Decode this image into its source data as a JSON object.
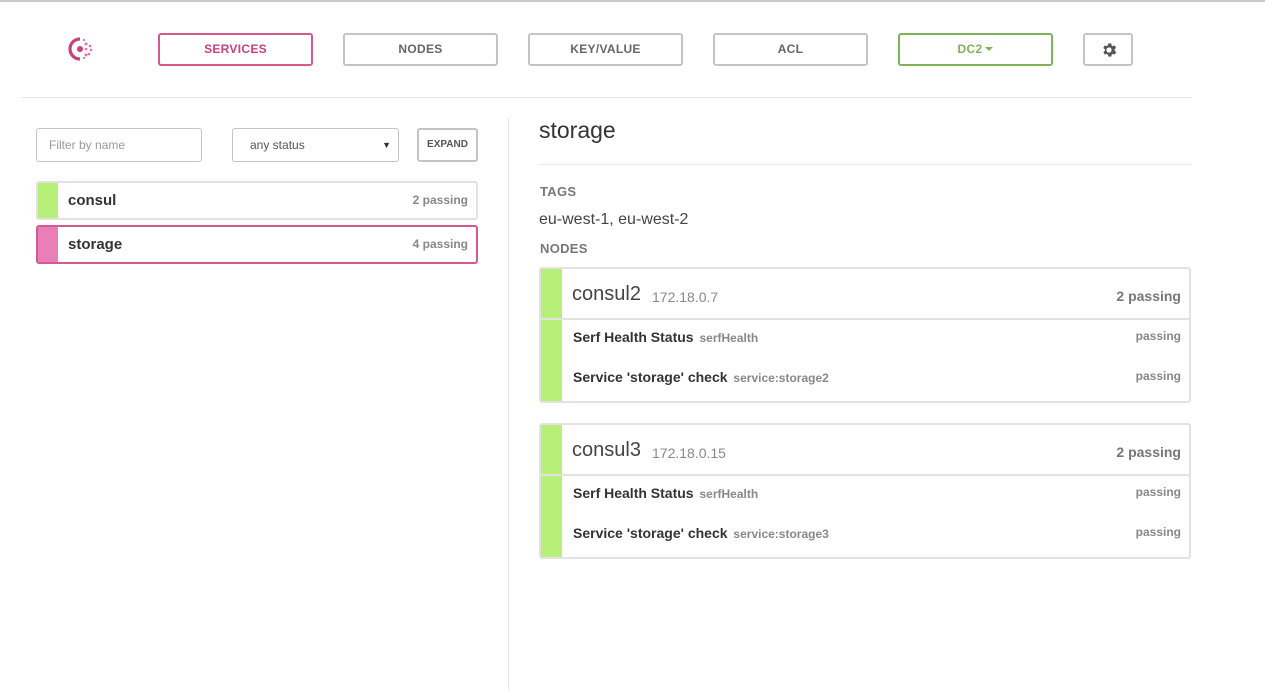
{
  "nav": {
    "items": [
      "SERVICES",
      "NODES",
      "KEY/VALUE",
      "ACL"
    ],
    "datacenter": "DC2",
    "accent_color": "#d5588f",
    "dc_color": "#7cb35b"
  },
  "filters": {
    "name_placeholder": "Filter by name",
    "status_value": "any status",
    "expand_label": "EXPAND"
  },
  "services": [
    {
      "name": "consul",
      "status": "2 passing",
      "color": "#b7ef79"
    },
    {
      "name": "storage",
      "status": "4 passing",
      "color": "#e87fb9"
    }
  ],
  "detail": {
    "title": "storage",
    "tags_label": "TAGS",
    "tags": "eu-west-1, eu-west-2",
    "nodes_label": "NODES",
    "nodes": [
      {
        "name": "consul2",
        "address": "172.18.0.7",
        "status": "2 passing",
        "checks": [
          {
            "name": "Serf Health Status",
            "id": "serfHealth",
            "status": "passing"
          },
          {
            "name": "Service 'storage' check",
            "id": "service:storage2",
            "status": "passing"
          }
        ]
      },
      {
        "name": "consul3",
        "address": "172.18.0.15",
        "status": "2 passing",
        "checks": [
          {
            "name": "Serf Health Status",
            "id": "serfHealth",
            "status": "passing"
          },
          {
            "name": "Service 'storage' check",
            "id": "service:storage3",
            "status": "passing"
          }
        ]
      }
    ]
  }
}
